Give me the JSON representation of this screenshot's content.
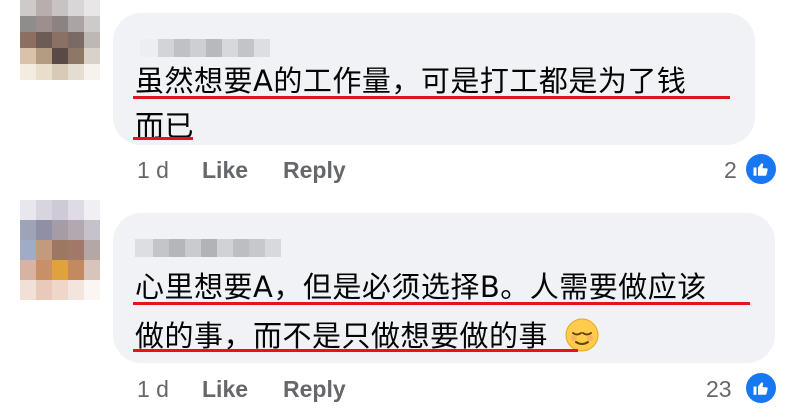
{
  "comments": [
    {
      "lines": [
        "虽然想要A的工作量，可是打工都是为了钱",
        "而已"
      ],
      "age": "1 d",
      "like_label": "Like",
      "reply_label": "Reply",
      "reaction_count": "2",
      "reaction_icon": "thumbs-up-icon"
    },
    {
      "lines": [
        "心里想要A，但是必须选择B。人需要做应该",
        "做的事，而不是只做想要做的事"
      ],
      "emoji": "relieved-face-emoji",
      "age": "1 d",
      "like_label": "Like",
      "reply_label": "Reply",
      "reaction_count": "23",
      "reaction_icon": "thumbs-up-icon"
    }
  ],
  "colors": {
    "bubble": "#f0f2f5",
    "underline": "#e0161c",
    "meta_text": "#65676b",
    "like_blue": "#1877f2"
  }
}
